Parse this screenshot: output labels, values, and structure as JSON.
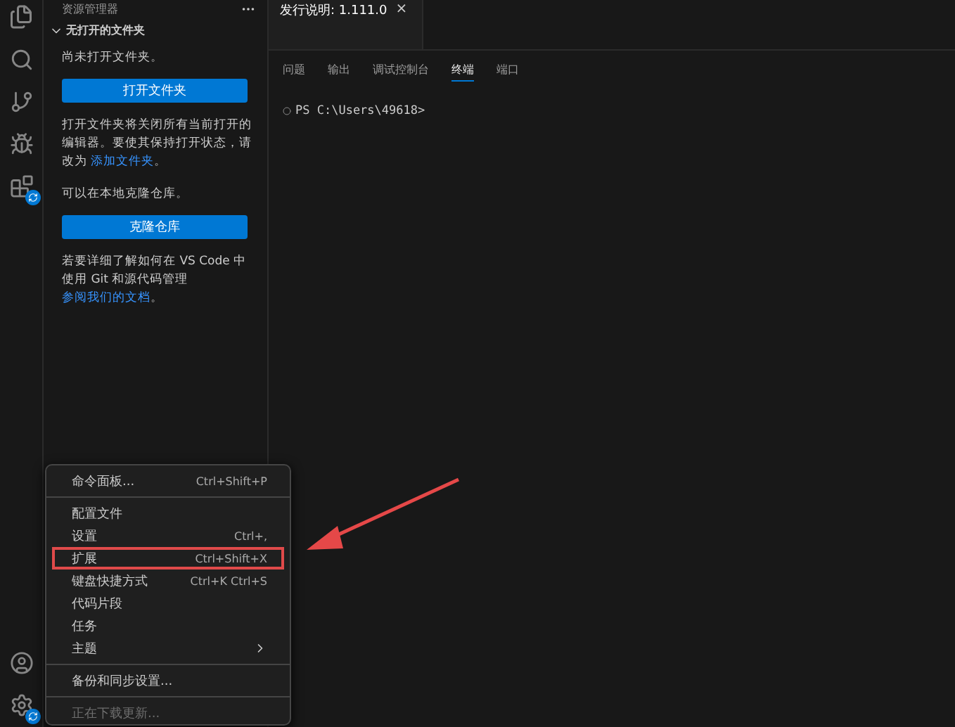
{
  "sidebar": {
    "title": "资源管理器",
    "section": {
      "label": "无打开的文件夹",
      "expanded": true
    },
    "paragraphs": [
      {
        "kind": "text",
        "text": "尚未打开文件夹。"
      },
      {
        "kind": "button",
        "text": "打开文件夹"
      },
      {
        "kind": "text",
        "text": "打开文件夹将关闭所有当前打开的编辑器。要使其保持打开状态，请改为 ",
        "link": "添加文件夹",
        "tail": "。"
      },
      {
        "kind": "text",
        "text": "可以在本地克隆仓库。"
      },
      {
        "kind": "button",
        "text": "克隆仓库"
      },
      {
        "kind": "text",
        "text": "若要详细了解如何在 VS Code 中使用 Git 和源代码管理",
        "link": "参阅我们的文档",
        "tail": "。"
      }
    ]
  },
  "editor": {
    "tabs": [
      {
        "label": "发行说明: 1.111.0",
        "close": "×"
      }
    ]
  },
  "panel": {
    "tabs": [
      {
        "label": "问题",
        "selected": false
      },
      {
        "label": "输出",
        "selected": false
      },
      {
        "label": "调试控制台",
        "selected": false
      },
      {
        "label": "终端",
        "selected": true
      },
      {
        "label": "端口",
        "selected": false
      }
    ],
    "terminal": [
      "PS C:\\Users\\49618>"
    ]
  },
  "menu": {
    "items": [
      {
        "kind": "item",
        "label": "命令面板...",
        "shortcut": "Ctrl+Shift+P",
        "highlighted": false,
        "disabled": false
      },
      {
        "kind": "separator"
      },
      {
        "kind": "item",
        "label": "配置文件",
        "highlighted": false,
        "disabled": false
      },
      {
        "kind": "item",
        "label": "设置",
        "shortcut": "Ctrl+,",
        "highlighted": false,
        "disabled": false
      },
      {
        "kind": "item",
        "label": "扩展",
        "shortcut": "Ctrl+Shift+X",
        "highlighted": true,
        "disabled": false
      },
      {
        "kind": "item",
        "label": "键盘快捷方式",
        "shortcut": "Ctrl+K Ctrl+S",
        "highlighted": false,
        "disabled": false
      },
      {
        "kind": "item",
        "label": "代码片段",
        "highlighted": false,
        "disabled": false
      },
      {
        "kind": "item",
        "label": "任务",
        "highlighted": false,
        "disabled": false
      },
      {
        "kind": "item",
        "label": "主题",
        "submenu": true,
        "highlighted": false,
        "disabled": false
      },
      {
        "kind": "separator"
      },
      {
        "kind": "item",
        "label": "备份和同步设置...",
        "highlighted": false,
        "disabled": false
      },
      {
        "kind": "separator"
      },
      {
        "kind": "item",
        "label": "正在下载更新...",
        "highlighted": false,
        "disabled": true
      }
    ]
  }
}
